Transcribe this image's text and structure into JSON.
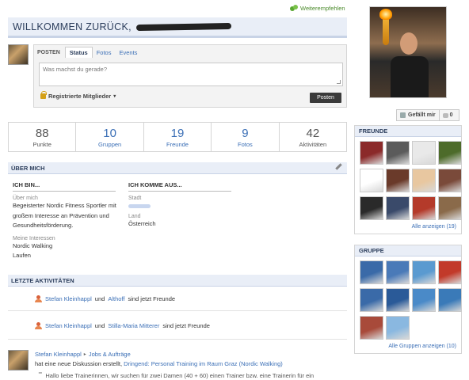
{
  "header": {
    "recommend_label": "Weiterempfehlen",
    "welcome_text": "WILLKOMMEN ZURÜCK,"
  },
  "composer": {
    "posten_label": "POSTEN",
    "tabs": [
      "Status",
      "Fotos",
      "Events"
    ],
    "placeholder": "Was machst du gerade?",
    "privacy_label": "Registrierte Mitglieder",
    "post_button": "Posten"
  },
  "stats": [
    {
      "value": "88",
      "label": "Punkte"
    },
    {
      "value": "10",
      "label": "Gruppen"
    },
    {
      "value": "19",
      "label": "Freunde"
    },
    {
      "value": "9",
      "label": "Fotos"
    },
    {
      "value": "42",
      "label": "Aktivitäten"
    }
  ],
  "about": {
    "title": "ÜBER MICH",
    "left_col_title": "ICH BIN...",
    "right_col_title": "ICH KOMME AUS...",
    "about_label": "Über mich",
    "about_text_1": "Begeisterter Nordic Fitness Sportler mit",
    "about_text_2": "großem Interesse an Prävention und",
    "about_text_3": "Gesundheitsförderung.",
    "interests_label": "Meine Interessen",
    "interest_1": "Nordic Walking",
    "interest_2": "Laufen",
    "city_label": "Stadt",
    "country_label": "Land",
    "country_value": "Österreich"
  },
  "activities": {
    "title": "LETZTE AKTIVITÄTEN",
    "items": [
      {
        "actor": "Stefan Kleinhappl",
        "connector": "und",
        "target": "Althoff",
        "suffix": "sind jetzt Freunde"
      },
      {
        "actor": "Stefan Kleinhappl",
        "connector": "und",
        "target": "Stilla-Maria Mitterer",
        "suffix": "sind jetzt Freunde"
      }
    ],
    "discussion": {
      "actor": "Stefan Kleinhappl",
      "group": "Jobs & Aufträge",
      "text": "hat eine neue Diskussion erstellt,",
      "link": "Dringend: Personal Training im Raum Graz (Nordic Walking)",
      "quote": "Hallo liebe Trainerinnen, wir suchen für zwei Damen (40 + 60) einen Trainer bzw. eine Trainerin für ein"
    }
  },
  "profile": {
    "like_label": "Gefällt mir",
    "comment_count": "0"
  },
  "friends": {
    "title": "FREUNDE",
    "show_all": "Alle anzeigen (19)",
    "colors": [
      "#8b2a2a",
      "#5b5b5b",
      "#e9e9e9",
      "#4d6b2a",
      "#ffffff",
      "#6a3a2a",
      "#e8c7a0",
      "#7a4a3a",
      "#2a2a2a",
      "#3a4a6a",
      "#b43a2a",
      "#8a6a4a"
    ]
  },
  "groups": {
    "title": "GRUPPE",
    "show_all": "Alle Gruppen anzeigen (10)",
    "colors": [
      "#3a6aa8",
      "#4a7ab8",
      "#5a9ad0",
      "#c23a2a",
      "#3a6aa8",
      "#2a5a98",
      "#4a8ac8",
      "#3a7ab8",
      "#a84a3a",
      "#8ab8e0"
    ]
  }
}
